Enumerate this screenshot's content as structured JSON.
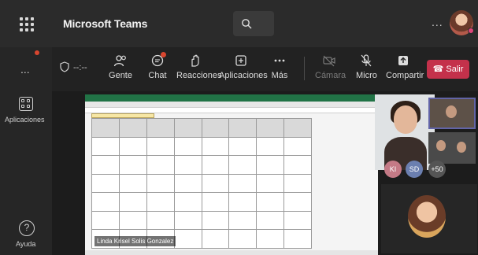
{
  "app": {
    "title": "Microsoft Teams"
  },
  "header": {
    "more_label": "...",
    "search_icon": "search-icon"
  },
  "rail": {
    "more_label": "...",
    "apps_label": "Aplicaciones",
    "help_label": "Ayuda"
  },
  "toolbar": {
    "timer": "--:--",
    "items": [
      {
        "label": "Gente",
        "icon": "people-icon"
      },
      {
        "label": "Chat",
        "icon": "chat-icon"
      },
      {
        "label": "Reacciones",
        "icon": "raise-hand-icon"
      },
      {
        "label": "Aplicaciones",
        "icon": "add-app-icon"
      },
      {
        "label": "Más",
        "icon": "more-icon"
      },
      {
        "label": "Cámara",
        "icon": "camera-off-icon"
      },
      {
        "label": "Micro",
        "icon": "mic-off-icon"
      },
      {
        "label": "Compartir",
        "icon": "share-icon"
      }
    ],
    "leave_label": "Salir",
    "leave_color": "#c4314b"
  },
  "stage": {
    "presenter_name": "Linda Krisel Solis Gonzalez",
    "participants": [
      "KI",
      "SD",
      "+50"
    ]
  },
  "colors": {
    "accent": "#6264a7",
    "excel": "#217346"
  }
}
